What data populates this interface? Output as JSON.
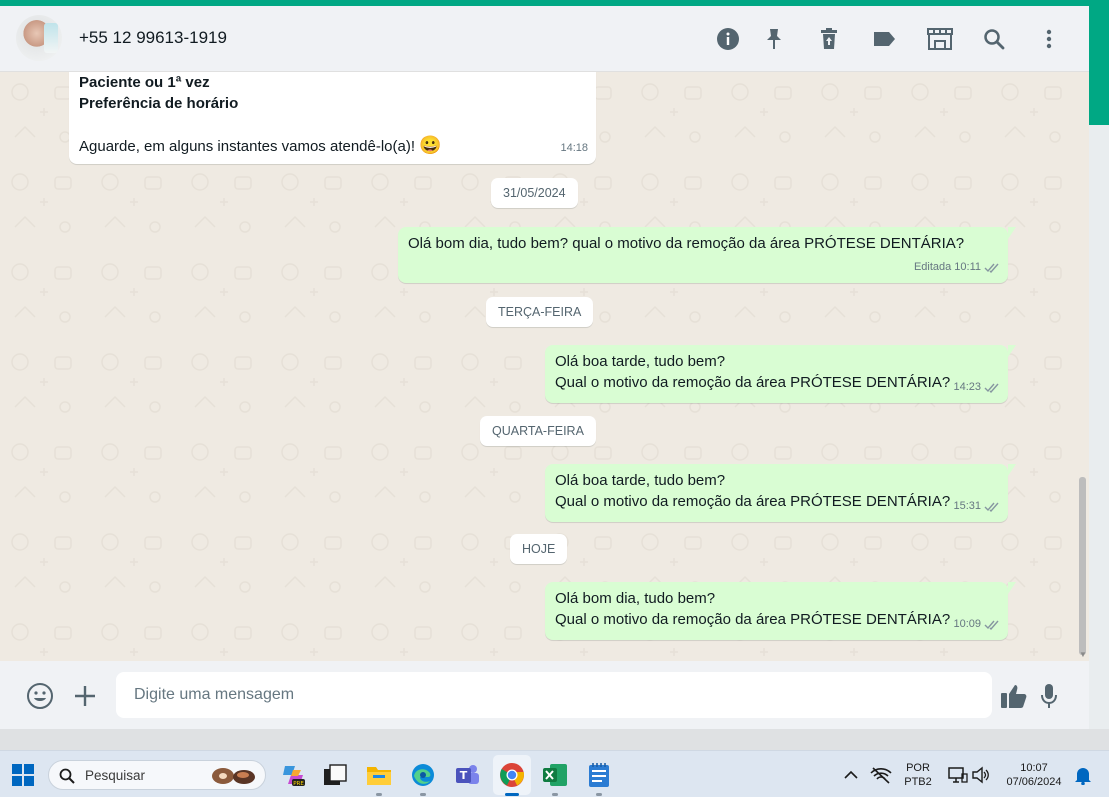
{
  "header": {
    "contact_name": "+55 12 99613-1919",
    "icons": [
      "info-icon",
      "pin-icon",
      "delete-icon",
      "label-icon",
      "store-icon",
      "search-icon",
      "menu-icon"
    ]
  },
  "messages": [
    {
      "direction": "in",
      "bold_lines": [
        "Paciente ou 1ª vez",
        "Preferência de horário"
      ],
      "text": "Aguarde, em alguns instantes vamos atendê-lo(a)!",
      "emoji": "😀",
      "time": "14:18"
    },
    {
      "type": "date",
      "label": "31/05/2024"
    },
    {
      "direction": "out",
      "lines": [
        "Olá bom dia, tudo bem? qual o motivo da remoção da área PRÓTESE DENTÁRIA?"
      ],
      "edited": "Editada",
      "time": "10:11"
    },
    {
      "type": "date",
      "label": "TERÇA-FEIRA"
    },
    {
      "direction": "out",
      "lines": [
        "Olá boa tarde, tudo bem?",
        "Qual o motivo da remoção da área PRÓTESE DENTÁRIA?"
      ],
      "time": "14:23"
    },
    {
      "type": "date",
      "label": "QUARTA-FEIRA"
    },
    {
      "direction": "out",
      "lines": [
        "Olá boa tarde, tudo bem?",
        "Qual o motivo da remoção da área PRÓTESE DENTÁRIA?"
      ],
      "time": "15:31"
    },
    {
      "type": "date",
      "label": "HOJE"
    },
    {
      "direction": "out",
      "lines": [
        "Olá bom dia, tudo bem?",
        "Qual o motivo da remoção da área PRÓTESE DENTÁRIA?"
      ],
      "time": "10:09"
    }
  ],
  "composer": {
    "placeholder": "Digite uma mensagem"
  },
  "taskbar": {
    "search_label": "Pesquisar",
    "language": "POR",
    "keyboard": "PTB2",
    "time": "10:07",
    "date": "07/06/2024"
  },
  "colors": {
    "accent": "#00a884",
    "outgoing_bubble": "#d9fdd3",
    "incoming_bubble": "#ffffff",
    "chat_background": "#efeae2"
  }
}
